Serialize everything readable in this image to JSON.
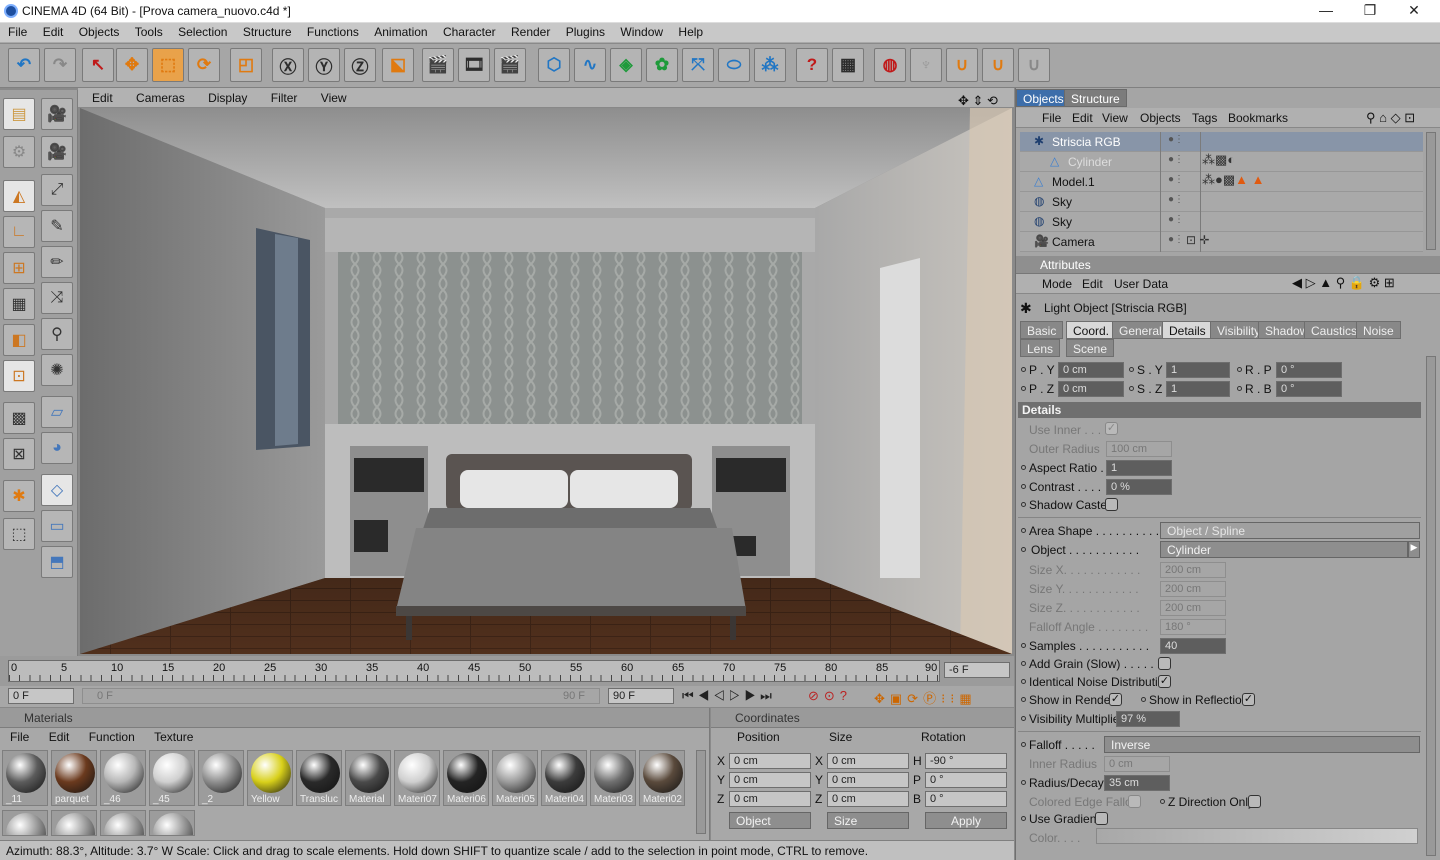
{
  "title": "CINEMA 4D (64 Bit) - [Prova camera_nuovo.c4d *]",
  "window_controls": [
    "—",
    "❐",
    "✕"
  ],
  "menu": [
    "File",
    "Edit",
    "Objects",
    "Tools",
    "Selection",
    "Structure",
    "Functions",
    "Animation",
    "Character",
    "Render",
    "Plugins",
    "Window",
    "Help"
  ],
  "viewport_menu": [
    "Edit",
    "Cameras",
    "Display",
    "Filter",
    "View"
  ],
  "timeline": {
    "ticks": [
      "0",
      "5",
      "10",
      "15",
      "20",
      "25",
      "30",
      "35",
      "40",
      "45",
      "50",
      "55",
      "60",
      "65",
      "70",
      "75",
      "80",
      "85",
      "90"
    ],
    "current_frame": "-6 F",
    "start": "0 F",
    "slider_start": "0 F",
    "slider_end": "90 F",
    "end": "90 F"
  },
  "materials": {
    "header": "Materials",
    "menu": [
      "File",
      "Edit",
      "Function",
      "Texture"
    ],
    "items": [
      {
        "label": "_11",
        "color": "#5c5c5c"
      },
      {
        "label": "parquet",
        "color": "#6b3a1e"
      },
      {
        "label": "_46",
        "color": "#b7b7b7"
      },
      {
        "label": "_45",
        "color": "#cfcfcf"
      },
      {
        "label": "_2",
        "color": "#8f8f8f"
      },
      {
        "label": "Yellow",
        "color": "#d8d01a"
      },
      {
        "label": "Transluc",
        "color": "#2a2a2a"
      },
      {
        "label": "Material",
        "color": "#4a4a4a"
      },
      {
        "label": "Materi07",
        "color": "#cfcfcf"
      },
      {
        "label": "Materi06",
        "color": "#242424"
      },
      {
        "label": "Materi05",
        "color": "#9c9c9c"
      },
      {
        "label": "Materi04",
        "color": "#3c3c3c"
      },
      {
        "label": "Materi03",
        "color": "#707070"
      },
      {
        "label": "Materi02",
        "color": "#5a4a3c"
      }
    ]
  },
  "coordinates": {
    "header": "Coordinates",
    "columns": [
      "Position",
      "Size",
      "Rotation"
    ],
    "rows": [
      {
        "axis": "X",
        "pos": "0 cm",
        "saxis": "X",
        "size": "0 cm",
        "raxis": "H",
        "rot": "-90 °"
      },
      {
        "axis": "Y",
        "pos": "0 cm",
        "saxis": "Y",
        "size": "0 cm",
        "raxis": "P",
        "rot": "0 °"
      },
      {
        "axis": "Z",
        "pos": "0 cm",
        "saxis": "Z",
        "size": "0 cm",
        "raxis": "B",
        "rot": "0 °"
      }
    ],
    "mode": "Object",
    "size_mode": "Size",
    "apply": "Apply"
  },
  "status": "Azimuth: 88.3°, Altitude: 3.7°  W   Scale: Click and drag to scale elements. Hold down SHIFT to quantize scale / add to the selection in point mode, CTRL to remove.",
  "objects": {
    "tabs": [
      "Objects",
      "Structure"
    ],
    "menu": [
      "File",
      "Edit",
      "View",
      "Objects",
      "Tags",
      "Bookmarks"
    ],
    "rows": [
      {
        "name": "Striscia RGB",
        "selected": true
      },
      {
        "name": "Cylinder",
        "selected": false
      },
      {
        "name": "Model.1",
        "selected": false
      },
      {
        "name": "Sky",
        "selected": false
      },
      {
        "name": "Sky",
        "selected": false
      },
      {
        "name": "Camera",
        "selected": false
      }
    ]
  },
  "attributes": {
    "header": "Attributes",
    "menu": [
      "Mode",
      "Edit",
      "User Data"
    ],
    "object_title": "Light Object [Striscia RGB]",
    "tabs_row1": [
      "Basic",
      "Coord.",
      "General",
      "Details",
      "Visibility",
      "Shadow",
      "Caustics",
      "Noise"
    ],
    "tabs_row2": [
      "Lens",
      "Scene"
    ],
    "active_tab": "Details",
    "coord": {
      "py": "0 cm",
      "pz": "0 cm",
      "sy": "1",
      "sz": "1",
      "rp": "0 °",
      "rb": "0 °"
    },
    "coord_labels": {
      "py": "P . Y",
      "pz": "P . Z",
      "sy": "S . Y",
      "sz": "S . Z",
      "rp": "R . P",
      "rb": "R . B"
    },
    "section": "Details",
    "use_inner": "Use Inner . . . .",
    "outer_radius": {
      "label": "Outer Radius",
      "value": "100 cm"
    },
    "aspect_ratio": {
      "label": "Aspect Ratio . .",
      "value": "1"
    },
    "contrast": {
      "label": "Contrast . . . .",
      "value": "0 %"
    },
    "shadow_caster": "Shadow Caster",
    "area_shape": {
      "label": "Area Shape . . . . . . . . . .",
      "value": "Object / Spline"
    },
    "object": {
      "label": "Object . . . . . . . . . . .",
      "value": "Cylinder"
    },
    "size_x": {
      "label": "Size X. . . . . . . . . . . .",
      "value": "200 cm"
    },
    "size_y": {
      "label": "Size Y. . . . . . . . . . . .",
      "value": "200 cm"
    },
    "size_z": {
      "label": "Size Z. . . . . . . . . . . .",
      "value": "200 cm"
    },
    "falloff_angle": {
      "label": "Falloff Angle . . . . . . . .",
      "value": "180 °"
    },
    "samples": {
      "label": "Samples . . . . . . . . . . .",
      "value": "40"
    },
    "add_grain": "Add Grain (Slow) . . . . . . .",
    "identical_noise": "Identical Noise Distribution",
    "show_in_render": "Show in Render",
    "show_in_reflection": "Show in Reflection",
    "visibility_multiplier": {
      "label": "Visibility Multiplier",
      "value": "97 %"
    },
    "falloff": {
      "label": "Falloff . . . . .",
      "value": "Inverse"
    },
    "inner_radius": {
      "label": "Inner Radius",
      "value": "0 cm"
    },
    "radius_decay": {
      "label": "Radius/Decay",
      "value": "35 cm"
    },
    "colored_edge": "Colored Edge Falloff",
    "z_direction": "Z Direction Only",
    "use_gradient": "Use Gradient",
    "color": "Color. . . ."
  },
  "colors": {
    "accent": "#3d6eaa",
    "panel": "#a5a5a5",
    "orange": "#e07a10"
  }
}
